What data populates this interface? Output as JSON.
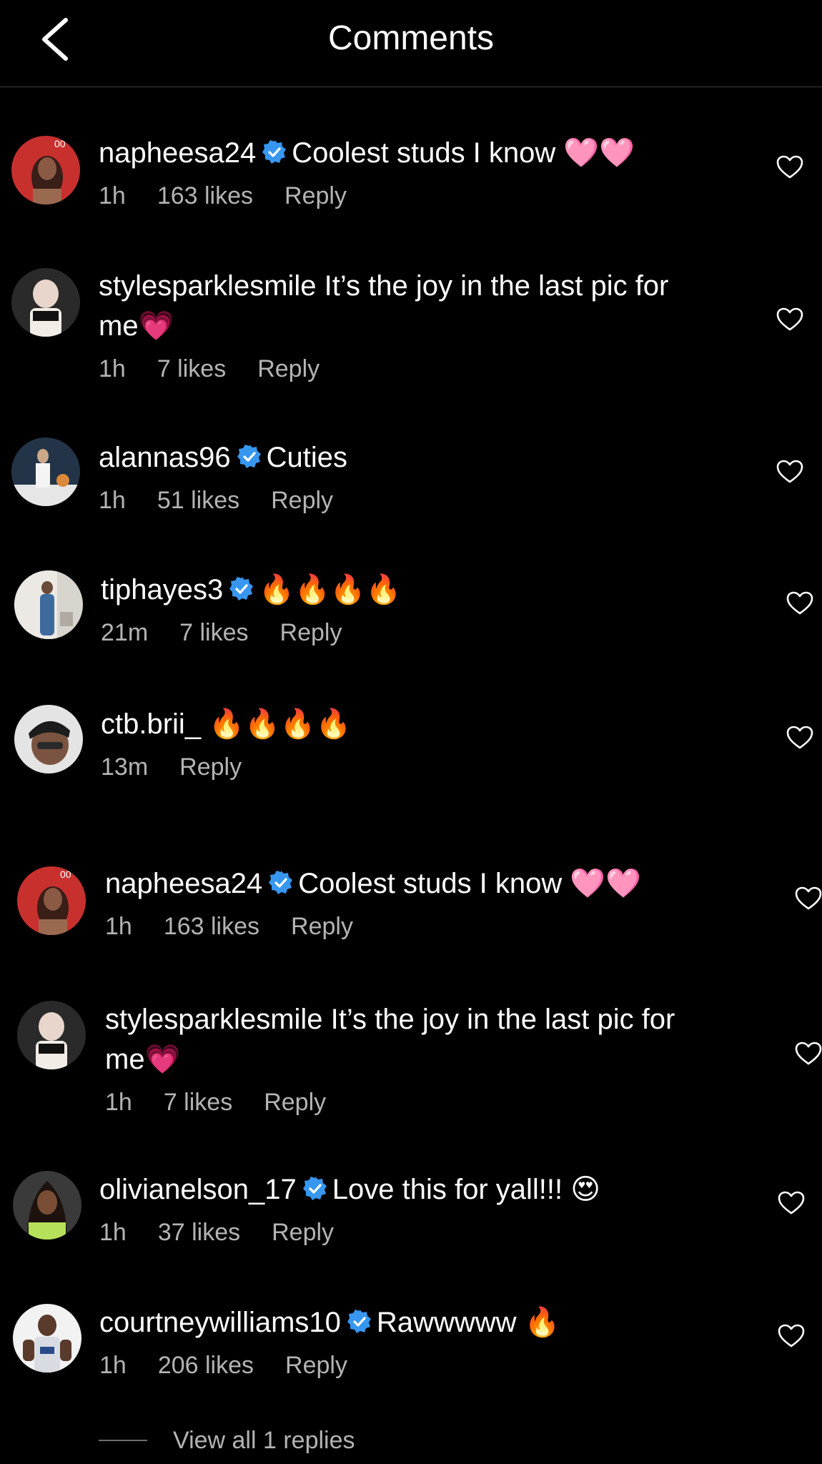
{
  "header": {
    "title": "Comments"
  },
  "comments": [
    {
      "username": "napheesa24",
      "verified": true,
      "text": "Coolest studs I know 🩷🩷",
      "time": "1h",
      "likes": "163 likes",
      "reply": "Reply"
    },
    {
      "username": "stylesparklesmile",
      "verified": false,
      "text": "It’s the joy in the last pic for me💗",
      "time": "1h",
      "likes": "7 likes",
      "reply": "Reply"
    },
    {
      "username": "alannas96",
      "verified": true,
      "text": "Cuties",
      "time": "1h",
      "likes": "51 likes",
      "reply": "Reply"
    },
    {
      "username": "tiphayes3",
      "verified": true,
      "text": "🔥🔥🔥🔥",
      "time": "21m",
      "likes": "7 likes",
      "reply": "Reply"
    },
    {
      "username": "ctb.brii_",
      "verified": false,
      "text": "🔥🔥🔥🔥",
      "time": "13m",
      "likes": "",
      "reply": "Reply"
    },
    {
      "username": "napheesa24",
      "verified": true,
      "text": "Coolest studs I know 🩷🩷",
      "time": "1h",
      "likes": "163 likes",
      "reply": "Reply"
    },
    {
      "username": "stylesparklesmile",
      "verified": false,
      "text": "It’s the joy in the last pic for me💗",
      "time": "1h",
      "likes": "7 likes",
      "reply": "Reply"
    },
    {
      "username": "olivianelson_17",
      "verified": true,
      "text": "Love this for yall!!! 😍",
      "time": "1h",
      "likes": "37 likes",
      "reply": "Reply"
    },
    {
      "username": "courtneywilliams10",
      "verified": true,
      "text": "Rawwwww 🔥",
      "time": "1h",
      "likes": "206 likes",
      "reply": "Reply"
    }
  ],
  "view_replies": "View all 1 replies",
  "colors": {
    "background": "#000000",
    "text": "#ffffff",
    "meta_text": "#b4b4b4",
    "verified": "#3797f0"
  }
}
